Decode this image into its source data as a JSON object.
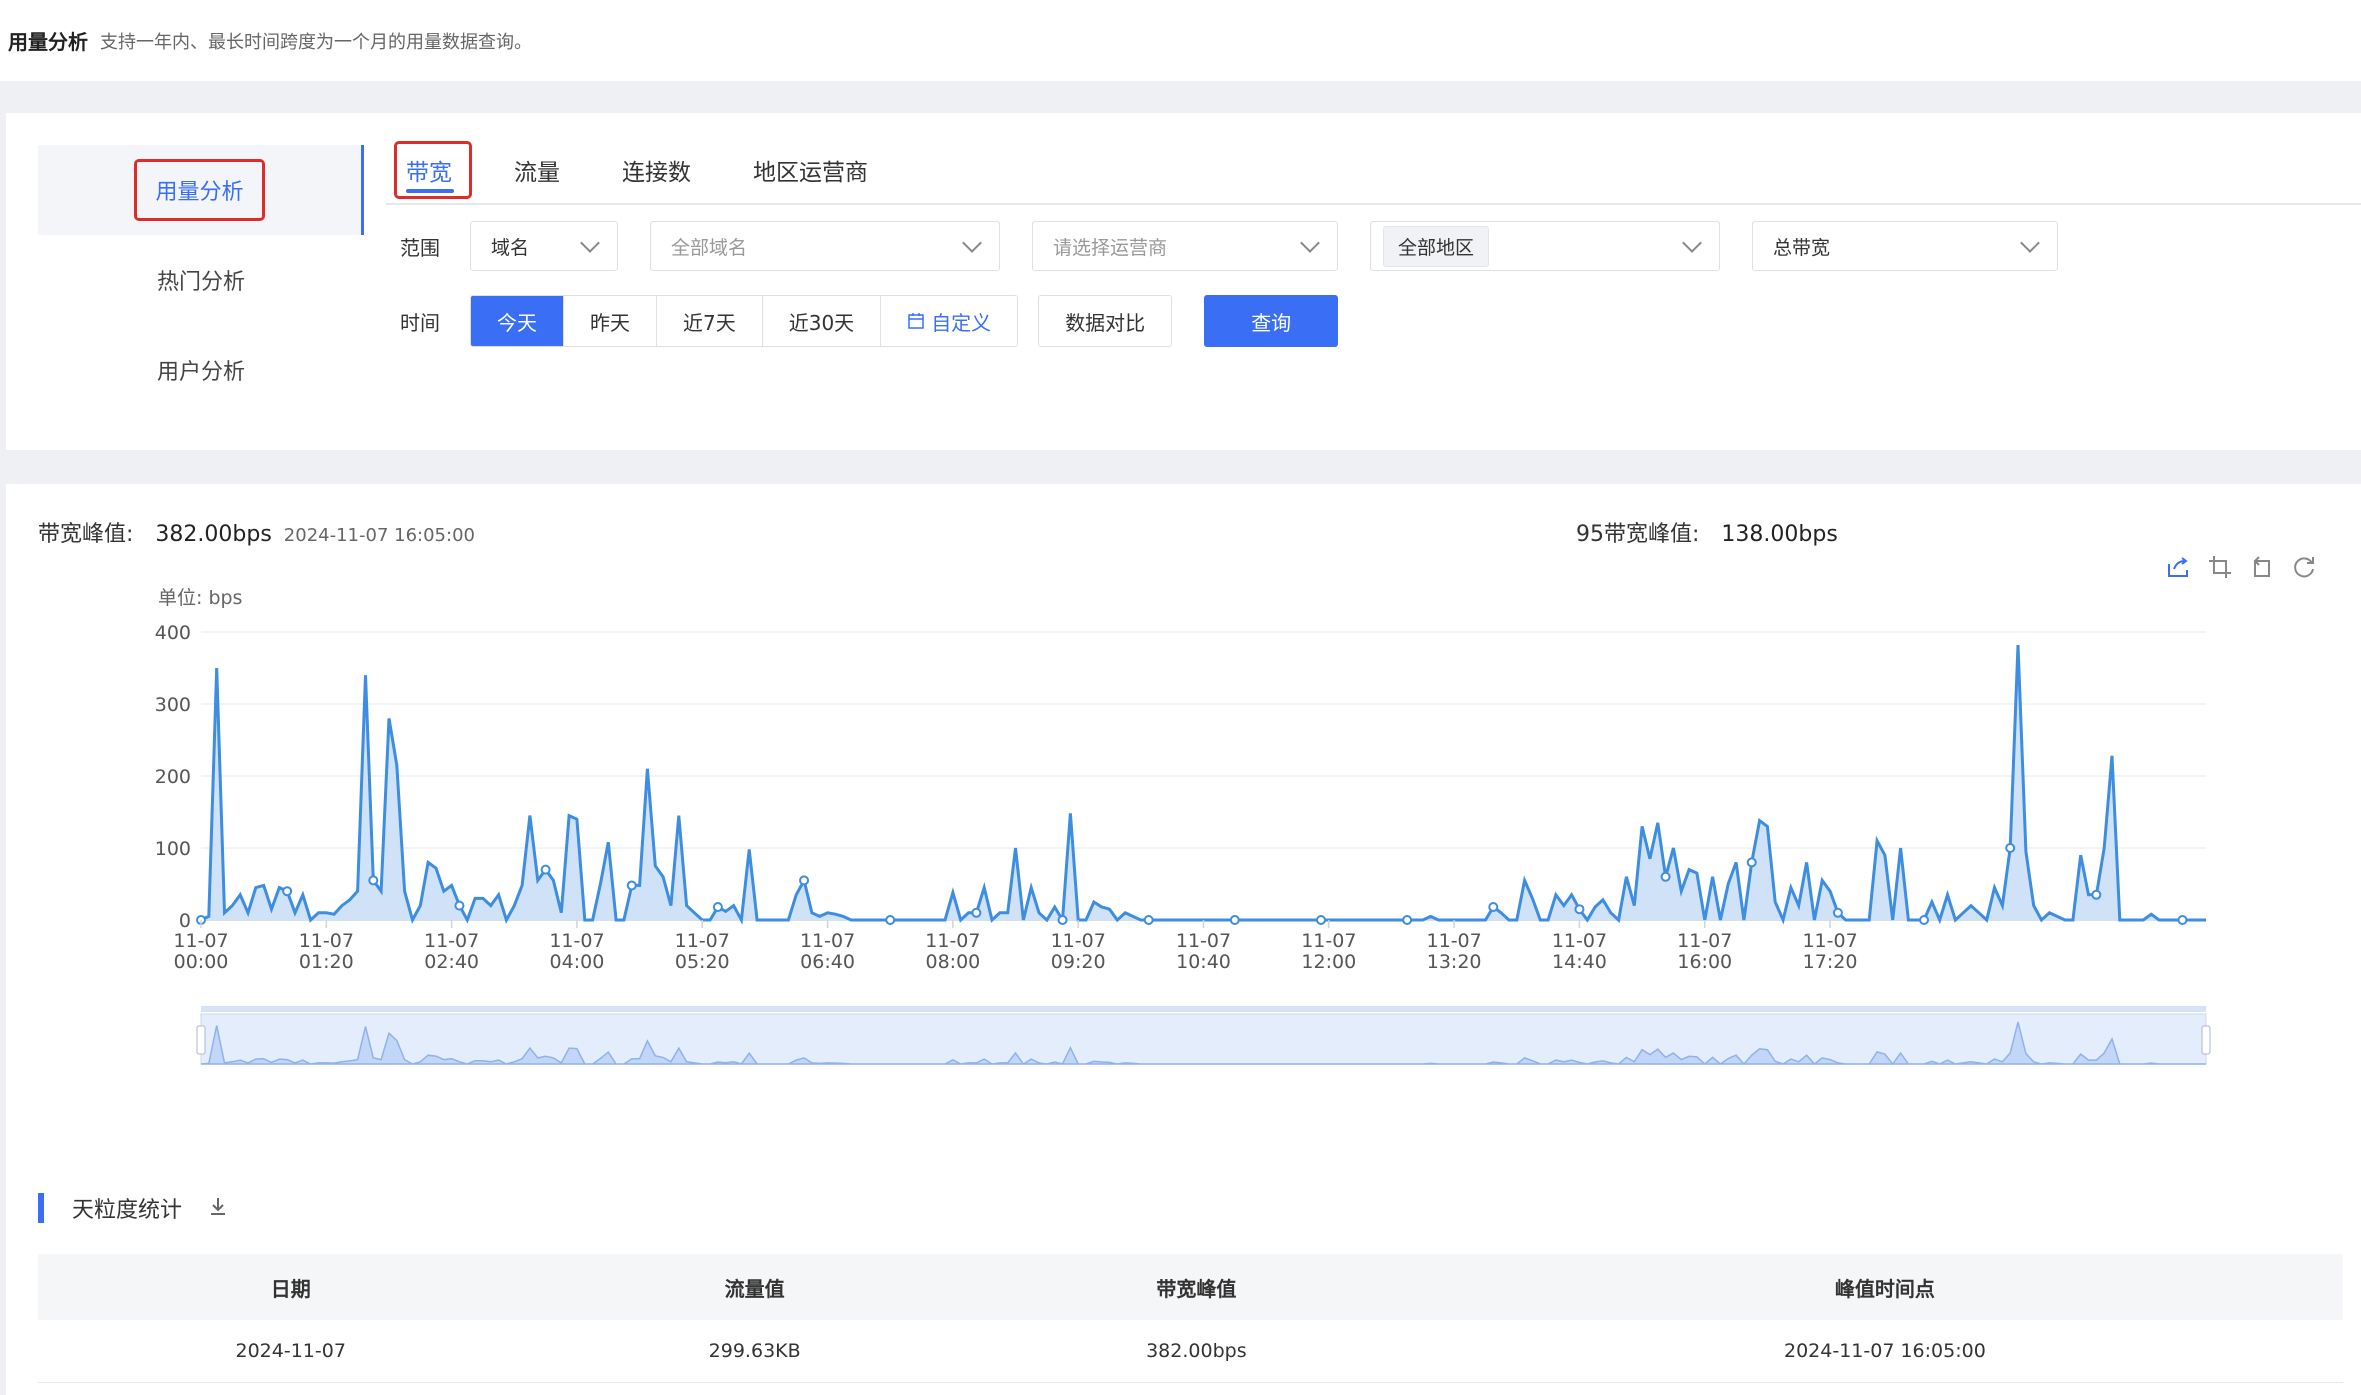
{
  "header": {
    "title": "用量分析",
    "description": "支持一年内、最长时间跨度为一个月的用量数据查询。"
  },
  "sidebar": {
    "items": [
      {
        "label": "用量分析",
        "active": true
      },
      {
        "label": "热门分析",
        "active": false
      },
      {
        "label": "用户分析",
        "active": false
      }
    ]
  },
  "tabs": [
    {
      "label": "带宽",
      "active": true
    },
    {
      "label": "流量",
      "active": false
    },
    {
      "label": "连接数",
      "active": false
    },
    {
      "label": "地区运营商",
      "active": false
    }
  ],
  "filters": {
    "scope_label": "范围",
    "scope_type": "域名",
    "domain_placeholder": "全部域名",
    "isp_placeholder": "请选择运营商",
    "region": "全部地区",
    "bandwidth_type": "总带宽"
  },
  "time": {
    "label": "时间",
    "options": [
      "今天",
      "昨天",
      "近7天",
      "近30天",
      "自定义"
    ],
    "selected": "今天",
    "compare_label": "数据对比",
    "query_label": "查询"
  },
  "stats": {
    "peak_label": "带宽峰值:",
    "peak_value": "382.00bps",
    "peak_time": "2024-11-07 16:05:00",
    "p95_label": "95带宽峰值:",
    "p95_value": "138.00bps"
  },
  "colors": {
    "accent": "#3a6ff5",
    "line": "#3d8de0",
    "area": "#b9d6f6",
    "highlight": "#e02b2b"
  },
  "chart_data": {
    "type": "area",
    "ylabel": "单位: bps",
    "ylim": [
      0,
      400
    ],
    "yticks": [
      0,
      100,
      200,
      300,
      400
    ],
    "x_ticks": [
      {
        "date": "11-07",
        "time": "00:00"
      },
      {
        "date": "11-07",
        "time": "01:20"
      },
      {
        "date": "11-07",
        "time": "02:40"
      },
      {
        "date": "11-07",
        "time": "04:00"
      },
      {
        "date": "11-07",
        "time": "05:20"
      },
      {
        "date": "11-07",
        "time": "06:40"
      },
      {
        "date": "11-07",
        "time": "08:00"
      },
      {
        "date": "11-07",
        "time": "09:20"
      },
      {
        "date": "11-07",
        "time": "10:40"
      },
      {
        "date": "11-07",
        "time": "12:00"
      },
      {
        "date": "11-07",
        "time": "13:20"
      },
      {
        "date": "11-07",
        "time": "14:40"
      },
      {
        "date": "11-07",
        "time": "16:00"
      },
      {
        "date": "11-07",
        "time": "17:20"
      }
    ],
    "interval_minutes": 5,
    "grid": true,
    "series": [
      {
        "values": [
          0,
          5,
          350,
          10,
          20,
          35,
          10,
          45,
          48,
          15,
          45,
          40,
          10,
          35,
          0,
          10,
          10,
          8,
          20,
          28,
          40,
          340,
          55,
          40,
          280,
          215,
          40,
          0,
          20,
          80,
          72,
          40,
          48,
          20,
          0,
          30,
          30,
          20,
          35,
          0,
          20,
          48,
          145,
          55,
          70,
          55,
          10,
          145,
          140,
          0,
          0,
          50,
          108,
          0,
          0,
          48,
          48,
          210,
          75,
          60,
          20,
          145,
          20,
          10,
          0,
          0,
          18,
          12,
          20,
          0,
          98,
          0,
          0,
          0,
          0,
          0,
          35,
          55,
          10,
          5,
          10,
          8,
          5,
          0,
          0,
          0,
          0,
          0,
          0,
          0,
          0,
          0,
          0,
          0,
          0,
          0,
          38,
          0,
          10,
          10,
          45,
          0,
          10,
          10,
          100,
          0,
          45,
          10,
          0,
          18,
          0,
          148,
          0,
          0,
          25,
          18,
          15,
          0,
          10,
          5,
          0,
          0,
          0,
          0,
          0,
          0,
          0,
          0,
          0,
          0,
          0,
          0,
          0,
          0,
          0,
          0,
          0,
          0,
          0,
          0,
          0,
          0,
          0,
          0,
          0,
          0,
          0,
          0,
          0,
          0,
          0,
          0,
          0,
          0,
          0,
          0,
          0,
          5,
          0,
          0,
          0,
          0,
          0,
          0,
          0,
          18,
          10,
          0,
          0,
          55,
          30,
          0,
          0,
          35,
          20,
          35,
          15,
          0,
          18,
          28,
          10,
          0,
          60,
          20,
          130,
          85,
          135,
          60,
          100,
          40,
          70,
          65,
          0,
          60,
          0,
          50,
          80,
          0,
          80,
          138,
          130,
          25,
          0,
          45,
          20,
          80,
          0,
          55,
          40,
          10,
          0,
          0,
          0,
          0,
          110,
          90,
          0,
          100,
          0,
          0,
          0,
          25,
          0,
          35,
          0,
          10,
          20,
          10,
          0,
          45,
          20,
          100,
          382,
          95,
          20,
          0,
          10,
          5,
          0,
          0,
          90,
          35,
          35,
          100,
          228,
          0,
          0,
          0,
          0,
          8,
          0,
          0,
          0,
          0,
          0,
          0,
          0
        ]
      }
    ]
  },
  "table": {
    "title": "天粒度统计",
    "columns": [
      "日期",
      "流量值",
      "带宽峰值",
      "峰值时间点"
    ],
    "rows": [
      [
        "2024-11-07",
        "299.63KB",
        "382.00bps",
        "2024-11-07 16:05:00"
      ]
    ]
  }
}
